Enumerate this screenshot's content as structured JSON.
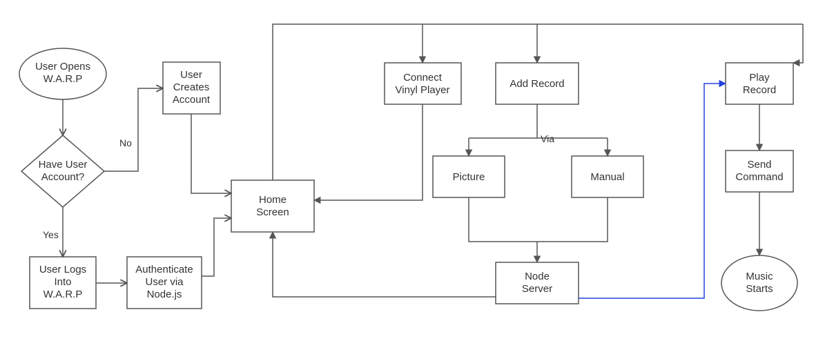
{
  "chart_data": {
    "type": "flowchart",
    "nodes": {
      "open": {
        "shape": "ellipse",
        "label": "User Opens\nW.A.R.P"
      },
      "haveAccount": {
        "shape": "decision",
        "label": "Have User\nAccount?"
      },
      "createAcct": {
        "shape": "process",
        "label": "User\nCreates\nAccount"
      },
      "login": {
        "shape": "process",
        "label": "User Logs\nInto\nW.A.R.P"
      },
      "auth": {
        "shape": "process",
        "label": "Authenticate\nUser via\nNode.js"
      },
      "home": {
        "shape": "process",
        "label": "Home\nScreen"
      },
      "connect": {
        "shape": "process",
        "label": "Connect\nVinyl Player"
      },
      "addRecord": {
        "shape": "process",
        "label": "Add Record"
      },
      "picture": {
        "shape": "process",
        "label": "Picture"
      },
      "manual": {
        "shape": "process",
        "label": "Manual"
      },
      "nodeServer": {
        "shape": "process",
        "label": "Node\nServer"
      },
      "play": {
        "shape": "process",
        "label": "Play\nRecord"
      },
      "sendCmd": {
        "shape": "process",
        "label": "Send\nCommand"
      },
      "music": {
        "shape": "ellipse",
        "label": "Music\nStarts"
      }
    },
    "edges": [
      {
        "from": "open",
        "to": "haveAccount"
      },
      {
        "from": "haveAccount",
        "to": "createAcct",
        "label": "No"
      },
      {
        "from": "haveAccount",
        "to": "login",
        "label": "Yes"
      },
      {
        "from": "login",
        "to": "auth"
      },
      {
        "from": "createAcct",
        "to": "home"
      },
      {
        "from": "auth",
        "to": "home"
      },
      {
        "from": "home",
        "to": "connect",
        "via": "top-bus"
      },
      {
        "from": "home",
        "to": "addRecord",
        "via": "top-bus"
      },
      {
        "from": "home",
        "to": "play",
        "via": "top-bus"
      },
      {
        "from": "connect",
        "to": "home"
      },
      {
        "from": "addRecord",
        "to": "picture",
        "label": "Via"
      },
      {
        "from": "addRecord",
        "to": "manual",
        "label": "Via"
      },
      {
        "from": "picture",
        "to": "nodeServer"
      },
      {
        "from": "manual",
        "to": "nodeServer"
      },
      {
        "from": "nodeServer",
        "to": "home"
      },
      {
        "from": "nodeServer",
        "to": "play",
        "color": "blue"
      },
      {
        "from": "play",
        "to": "sendCmd"
      },
      {
        "from": "sendCmd",
        "to": "music"
      }
    ],
    "edge_labels": {
      "no": "No",
      "yes": "Yes",
      "via": "Via"
    }
  }
}
